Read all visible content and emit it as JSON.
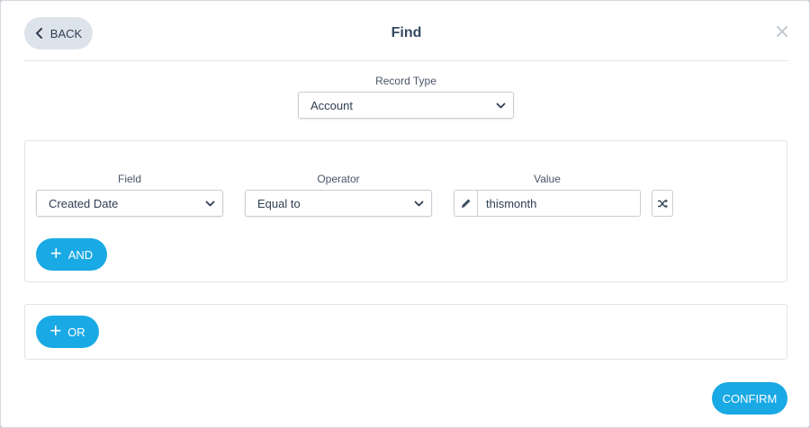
{
  "header": {
    "back_label": "BACK",
    "title": "Find"
  },
  "record_type": {
    "label": "Record Type",
    "selected": "Account"
  },
  "filter": {
    "field_label": "Field",
    "field_value": "Created Date",
    "operator_label": "Operator",
    "operator_value": "Equal to",
    "value_label": "Value",
    "value_text": "thismonth",
    "and_label": "AND"
  },
  "or_group": {
    "or_label": "OR"
  },
  "footer": {
    "confirm_label": "CONFIRM"
  },
  "colors": {
    "accent": "#19a9e5",
    "back_bg": "#dde3ea",
    "text": "#2f3e52"
  },
  "icons": [
    "chevron-left-icon",
    "close-icon",
    "chevron-down-icon",
    "pencil-icon",
    "shuffle-icon",
    "plus-icon"
  ]
}
